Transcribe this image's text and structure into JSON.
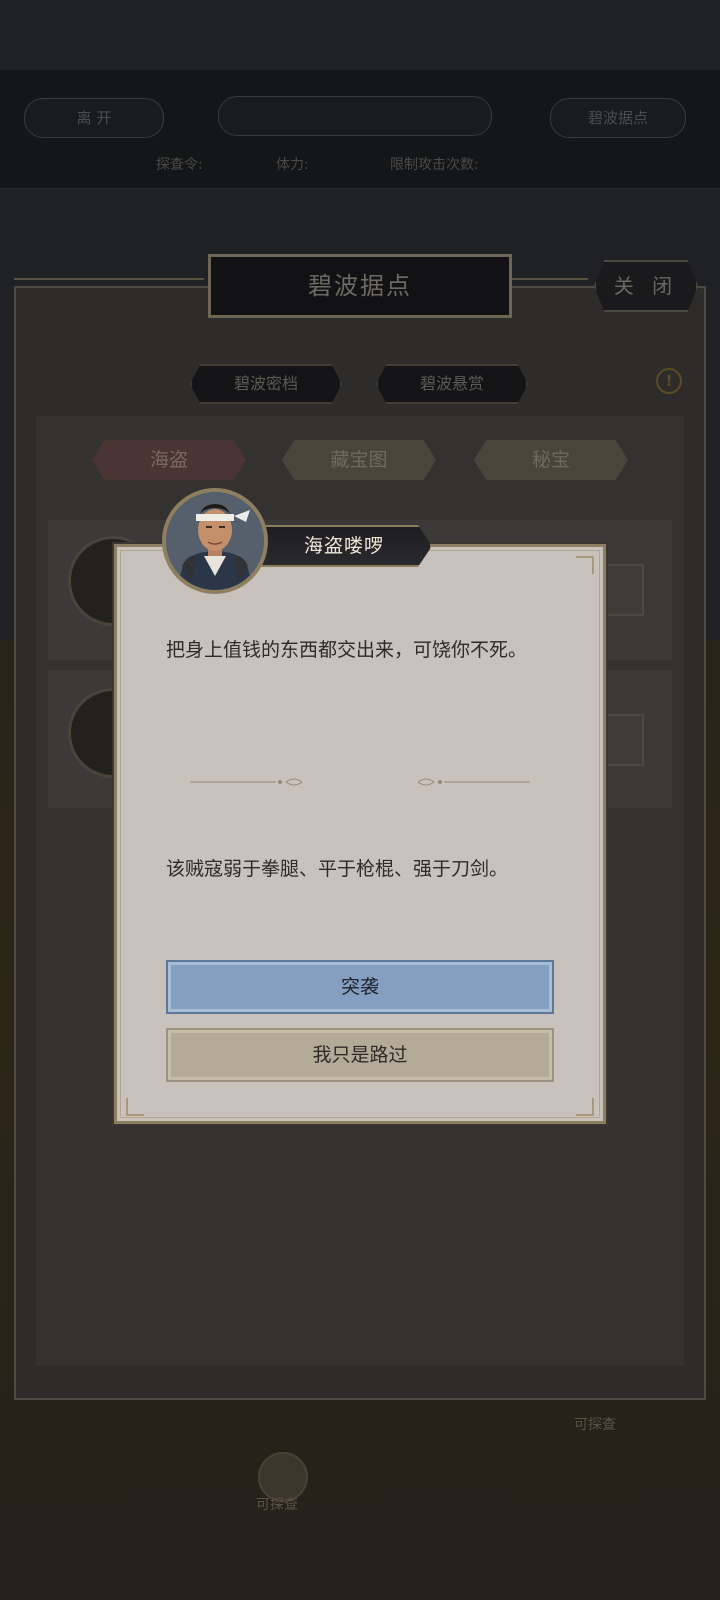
{
  "background": {
    "leave_button": "离 开",
    "header_center": "",
    "location_button": "碧波据点",
    "stats": [
      "探查令:",
      "体力:",
      "限制攻击次数:"
    ],
    "scene_labels": [
      "可探查",
      "可探查"
    ]
  },
  "panel": {
    "title": "碧波据点",
    "close_label": "关 闭",
    "tabs": [
      "碧波密档",
      "碧波悬赏"
    ],
    "info_icon": "!",
    "subtabs": [
      "海盗",
      "藏宝图",
      "秘宝"
    ]
  },
  "dialog": {
    "speaker": "海盗喽啰",
    "message": "把身上值钱的东西都交出来，可饶你不死。",
    "hint": "该贼寇弱于拳腿、平于枪棍、强于刀剑。",
    "attack_label": "突袭",
    "pass_label": "我只是路过"
  },
  "colors": {
    "attack_button": "#849fc0",
    "pass_button": "#b4aa98",
    "dialog_bg": "#c9c1bc",
    "accent_gold": "#8d7f62"
  }
}
